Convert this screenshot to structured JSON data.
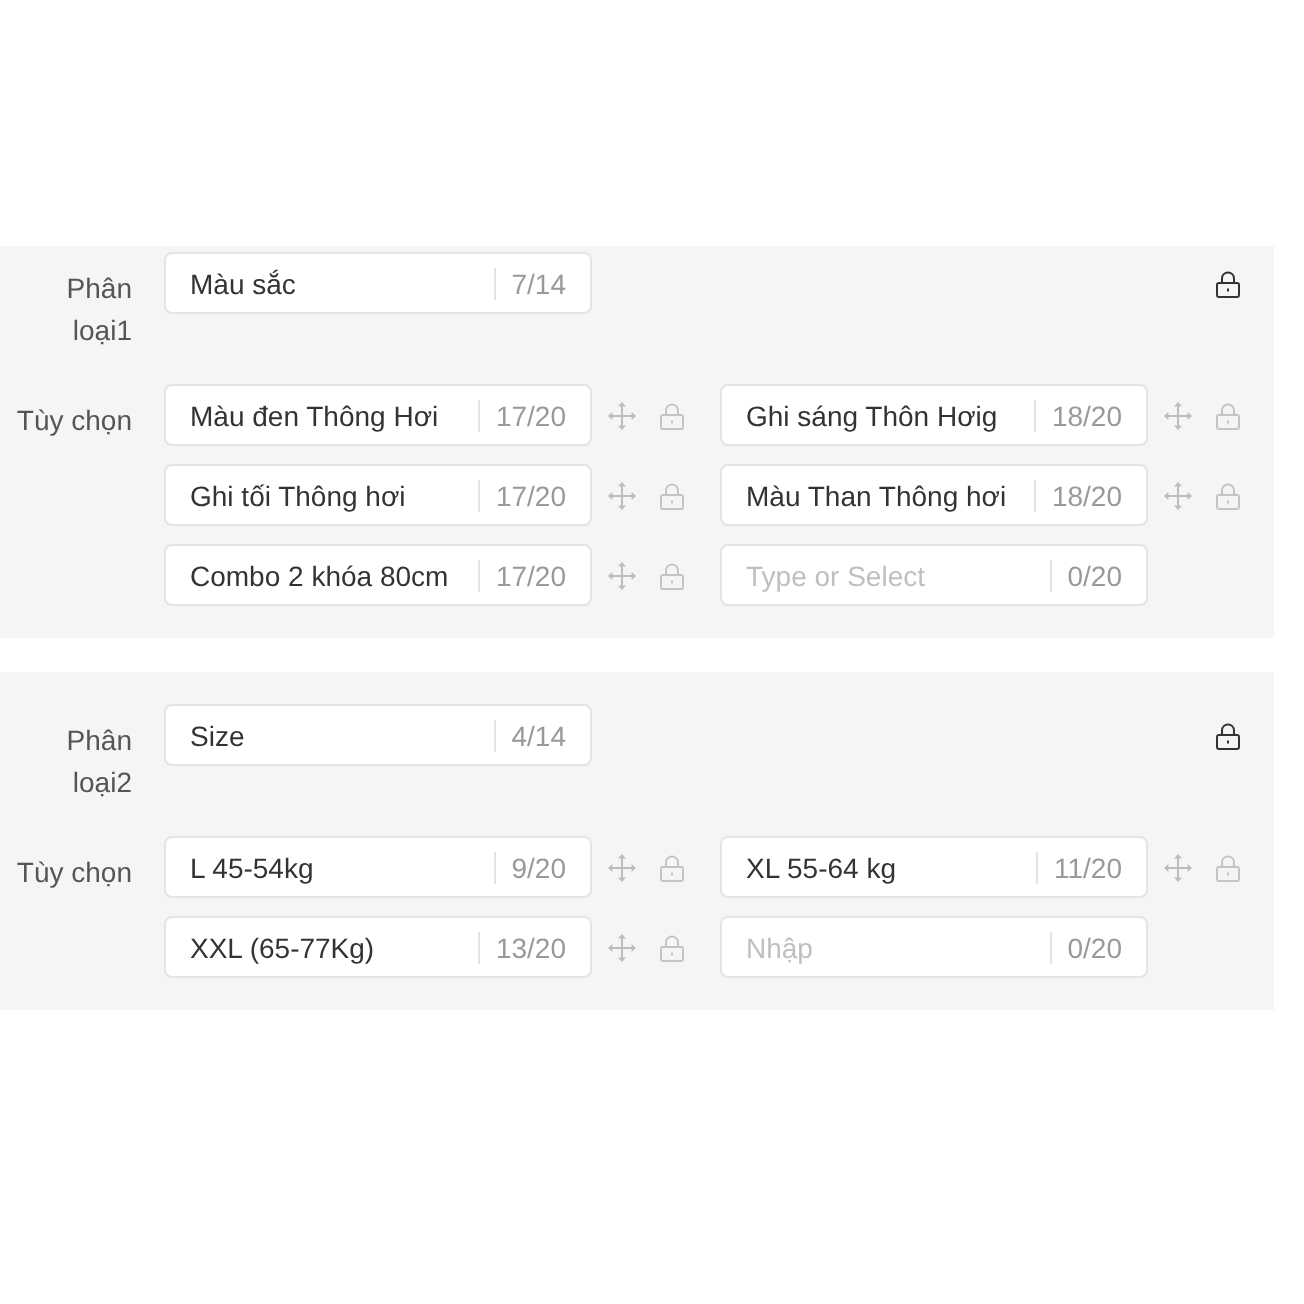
{
  "groups": [
    {
      "label": "Phân loại1",
      "name_field": {
        "value": "Màu sắc",
        "count": "7/14"
      },
      "options_label": "Tùy chọn",
      "options": [
        {
          "kind": "entry",
          "value": "Màu đen Thông Hơi",
          "count": "17/20"
        },
        {
          "kind": "entry",
          "value": "Ghi sáng Thôn Hơig",
          "count": "18/20"
        },
        {
          "kind": "entry",
          "value": "Ghi tối Thông hơi",
          "count": "17/20"
        },
        {
          "kind": "entry",
          "value": "Màu Than Thông hơi",
          "count": "18/20"
        },
        {
          "kind": "entry",
          "value": "Combo 2 khóa 80cm",
          "count": "17/20"
        },
        {
          "kind": "blank",
          "placeholder": "Type or Select",
          "count": "0/20"
        }
      ]
    },
    {
      "label": "Phân loại2",
      "name_field": {
        "value": "Size",
        "count": "4/14"
      },
      "options_label": "Tùy chọn",
      "options": [
        {
          "kind": "entry",
          "value": "L 45-54kg",
          "count": "9/20"
        },
        {
          "kind": "entry",
          "value": "XL 55-64 kg",
          "count": "11/20"
        },
        {
          "kind": "entry",
          "value": "XXL (65-77Kg)",
          "count": "13/20"
        },
        {
          "kind": "blank",
          "placeholder": "Nhập",
          "count": "0/20"
        }
      ]
    }
  ]
}
